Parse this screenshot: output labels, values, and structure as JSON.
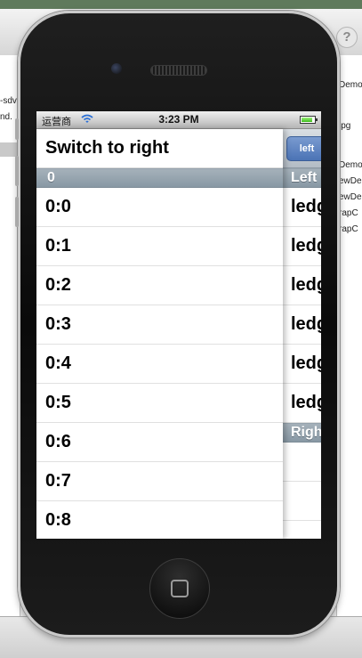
{
  "background": {
    "left_texts": [
      "-sdv",
      "nd."
    ],
    "right_texts": [
      "Demo",
      "jpg",
      "Demo",
      "ewDe",
      "ewDe",
      "rapC",
      "rapC"
    ],
    "help_label": "?"
  },
  "status_bar": {
    "carrier": "运营商",
    "time": "3:23 PM",
    "battery_level": 0.85
  },
  "main": {
    "header_title": "Switch to right",
    "section_title": "0",
    "rows": [
      "0:0",
      "0:1",
      "0:2",
      "0:3",
      "0:4",
      "0:5",
      "0:6",
      "0:7",
      "0:8"
    ]
  },
  "side": {
    "button_label": "left",
    "section_left": "Left",
    "rows": [
      "ledg",
      "ledg",
      "ledg",
      "ledg",
      "ledg",
      "ledg"
    ],
    "section_right": "Righ"
  },
  "colors": {
    "section_header": "#8898a4",
    "button_blue": "#4b73b5"
  }
}
